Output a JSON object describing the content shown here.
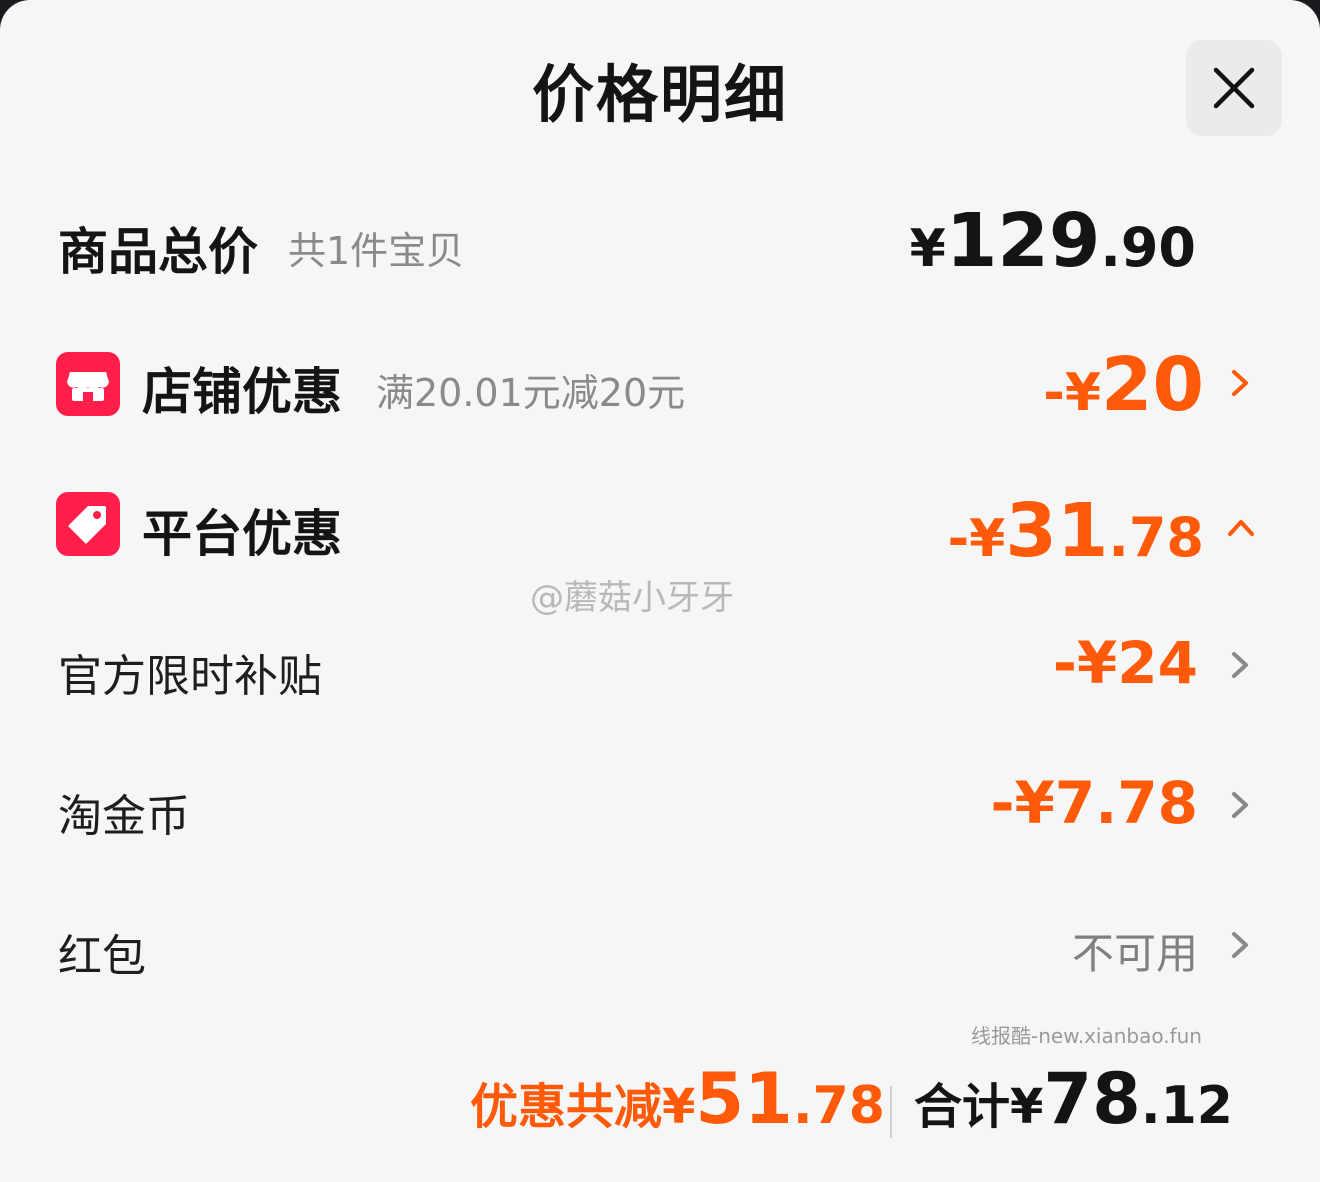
{
  "header": {
    "title": "价格明细"
  },
  "items_total": {
    "label": "商品总价",
    "sub": "共1件宝贝",
    "currency": "¥",
    "amount_int": "129",
    "amount_dec": ".90"
  },
  "shop_discount": {
    "label": "店铺优惠",
    "sub": "满20.01元减20元",
    "prefix": "-¥",
    "amount_int": "20",
    "amount_dec": ""
  },
  "platform_discount": {
    "label": "平台优惠",
    "prefix": "-¥",
    "amount_int": "31",
    "amount_dec": ".78"
  },
  "sub_items": [
    {
      "label": "官方限时补贴",
      "value": "-¥24"
    },
    {
      "label": "淘金币",
      "value": "-¥7.78"
    },
    {
      "label": "红包",
      "value": "不可用"
    }
  ],
  "watermark": "@蘑菇小牙牙",
  "watermark_site": "线报酷-new.xianbao.fun",
  "footer": {
    "discount_label": "优惠共减¥",
    "discount_int": "51",
    "discount_dec": ".78",
    "total_label": "合计¥",
    "total_int": "78",
    "total_dec": ".12"
  },
  "colors": {
    "accent": "#ff5a0a",
    "badge": "#ff1f4a",
    "text": "#141414",
    "muted": "#8a8a8a"
  }
}
